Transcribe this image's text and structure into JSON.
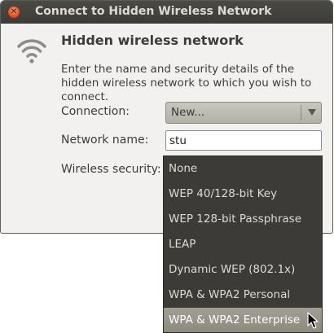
{
  "window": {
    "title": "Connect to Hidden Wireless Network"
  },
  "main": {
    "heading": "Hidden wireless network",
    "description": "Enter the name and security details of the hidden wireless network to which you wish to connect."
  },
  "form": {
    "connection_label": "Connection:",
    "connection_value": "New...",
    "network_name_label": "Network name:",
    "network_name_value": "stu",
    "security_label": "Wireless security:"
  },
  "security_menu": {
    "items": [
      "None",
      "WEP 40/128-bit Key",
      "WEP 128-bit Passphrase",
      "LEAP",
      "Dynamic WEP (802.1x)",
      "WPA & WPA2 Personal",
      "WPA & WPA2 Enterprise"
    ],
    "highlighted": "WPA & WPA2 Enterprise"
  },
  "icons": {
    "close": "close-icon",
    "wifi": "wifi-icon",
    "dropdown_arrow": "chevron-down-icon",
    "cursor": "mouse-pointer-icon"
  },
  "colors": {
    "titlebar": "#3c3b37",
    "close_button": "#e0552a",
    "menu_background": "#3c3b37",
    "menu_highlight": "#97938a"
  }
}
